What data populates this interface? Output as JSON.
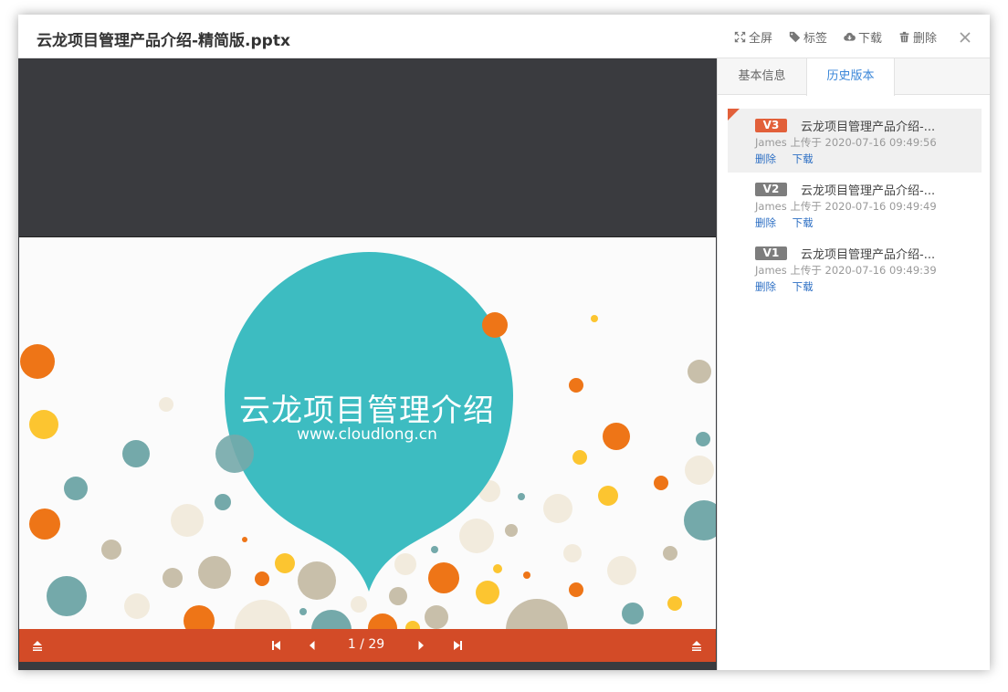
{
  "header": {
    "title": "云龙项目管理产品介绍-精简版.pptx",
    "actions": {
      "fullscreen": "全屏",
      "tag": "标签",
      "download": "下载",
      "delete": "删除"
    }
  },
  "icons": {
    "fullscreen": "expand-icon",
    "tag": "tag-icon",
    "download": "cloud-download-icon",
    "delete": "trash-icon",
    "close": "close-icon"
  },
  "slide": {
    "title": "云龙项目管理介绍",
    "url": "www.cloudlong.cn",
    "colors": {
      "teal": "#3dbcc1",
      "orange": "#ee7517",
      "yellow": "#fcc530",
      "beige": "#f2ebdd",
      "gray": "#c8bfaa",
      "slate": "#74a9aa"
    }
  },
  "toolbar": {
    "page_indicator": "1 / 29",
    "color": "#d34b27"
  },
  "tabs": {
    "basic": "基本信息",
    "history": "历史版本"
  },
  "versions": [
    {
      "badge": "V3",
      "badge_color": "#e2603a",
      "name": "云龙项目管理产品介绍-...",
      "meta": "James 上传于 2020-07-16 09:49:56",
      "delete": "删除",
      "download": "下载"
    },
    {
      "badge": "V2",
      "badge_color": "#7d7d7d",
      "name": "云龙项目管理产品介绍-...",
      "meta": "James 上传于 2020-07-16 09:49:49",
      "delete": "删除",
      "download": "下载"
    },
    {
      "badge": "V1",
      "badge_color": "#7d7d7d",
      "name": "云龙项目管理产品介绍-...",
      "meta": "James 上传于 2020-07-16 09:49:39",
      "delete": "删除",
      "download": "下载"
    }
  ]
}
